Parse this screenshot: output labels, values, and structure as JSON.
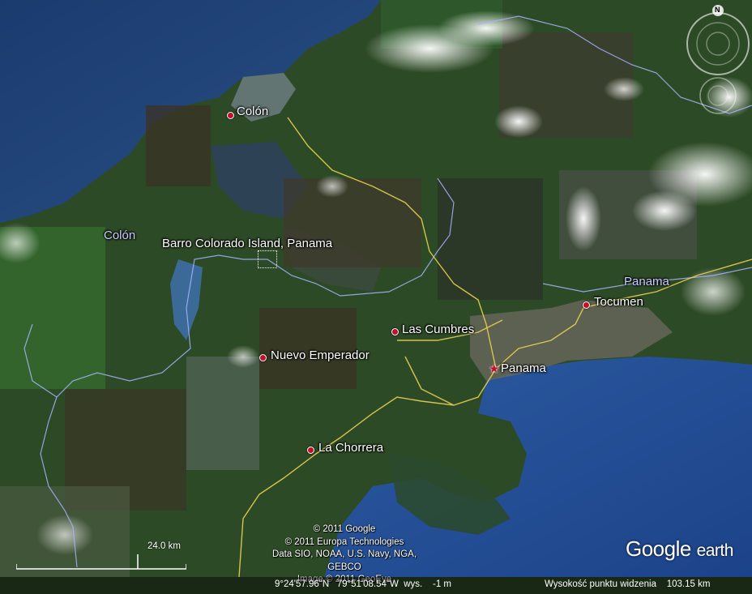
{
  "places": [
    {
      "name": "Colón",
      "type": "city"
    },
    {
      "name": "Colón",
      "type": "region"
    },
    {
      "name": "Barro Colorado Island, Panama",
      "type": "placemark"
    },
    {
      "name": "Las Cumbres",
      "type": "city"
    },
    {
      "name": "Nuevo Emperador",
      "type": "city"
    },
    {
      "name": "Panama",
      "type": "capital"
    },
    {
      "name": "Tocumen",
      "type": "city"
    },
    {
      "name": "Panama",
      "type": "region"
    },
    {
      "name": "La Chorrera",
      "type": "city"
    }
  ],
  "copyright": [
    "© 2011 Google",
    "© 2011 Europa Technologies",
    "Data SIO, NOAA, U.S. Navy, NGA, GEBCO",
    "Image © 2011 GeoEye"
  ],
  "status": {
    "coordinates": "9°24'57.96\"N   79°51'08.54\"W  wys.    -1 m",
    "altitude": "Wysokość punktu widzenia    103.15 km"
  },
  "scale": {
    "label": "24.0 km"
  },
  "logo": {
    "google": "Google",
    "earth": "earth"
  },
  "navigation": {
    "north": "N"
  },
  "colors": {
    "road": "#e8d050",
    "border": "#a8b4ff",
    "marker": "#c0102a",
    "sea": "#1d3e7a"
  }
}
